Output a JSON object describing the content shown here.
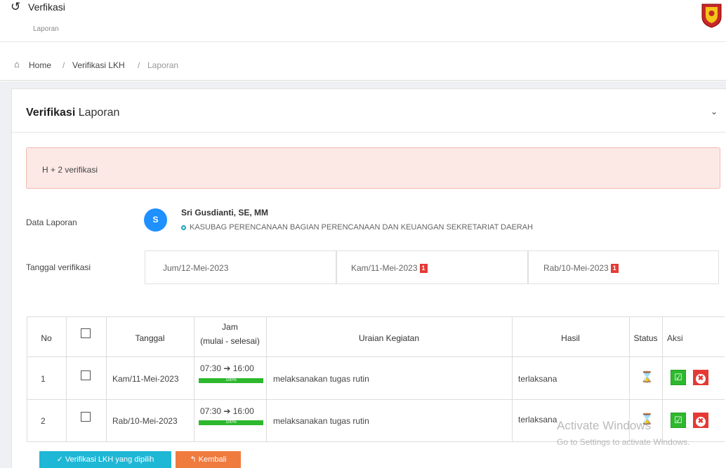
{
  "topbar": {
    "back_icon": "arrow-left-circle-icon",
    "title": "Verfikasi",
    "subtitle": "Laporan"
  },
  "breadcrumb": {
    "home_icon": "home-icon",
    "items": [
      "Home",
      "Verifikasi LKH",
      "Laporan"
    ],
    "separator": "/"
  },
  "card": {
    "title_bold": "Verifikasi",
    "title_rest": " Laporan",
    "collapse_icon": "chevron-down-icon"
  },
  "alert": {
    "text": "H + 2 verifikasi"
  },
  "report": {
    "label": "Data Laporan",
    "avatar_initial": "S",
    "name": "Sri Gusdianti, SE, MM",
    "role": "KASUBAG PERENCANAAN BAGIAN PERENCANAAN DAN KEUANGAN SEKRETARIAT DAERAH"
  },
  "verification_dates": {
    "label": "Tanggal verifikasi",
    "dates": [
      {
        "text": "Jum/12-Mei-2023",
        "badge": ""
      },
      {
        "text": "Kam/11-Mei-2023",
        "badge": "1"
      },
      {
        "text": "Rab/10-Mei-2023",
        "badge": "1"
      }
    ]
  },
  "table": {
    "headers": {
      "no": "No",
      "tanggal": "Tanggal",
      "jam_top": "Jam",
      "jam_bottom": "(mulai - selesai)",
      "uraian": "Uraian Kegiatan",
      "hasil": "Hasil",
      "status": "Status",
      "aksi": "Aksi"
    },
    "rows": [
      {
        "no": "1",
        "tanggal": "Kam/11-Mei-2023",
        "jam": "07:30 ➔ 16:00",
        "progress_label": "100%",
        "progress_pct": 100,
        "uraian": "melaksanakan tugas rutin",
        "hasil": "terlaksana",
        "status_icon": "hourglass-icon"
      },
      {
        "no": "2",
        "tanggal": "Rab/10-Mei-2023",
        "jam": "07:30 ➔ 16:00",
        "progress_label": "100%",
        "progress_pct": 100,
        "uraian": "melaksanakan tugas rutin",
        "hasil": "terlaksana",
        "status_icon": "hourglass-icon"
      }
    ]
  },
  "actions": {
    "verify_label": "✓ Verifikasi LKH yang dipilih",
    "back_label": "↰ Kembali"
  },
  "watermark": {
    "line1": "Activate Windows",
    "line2": "Go to Settings to activate Windows."
  },
  "colors": {
    "accent_blue": "#1e90ff",
    "verify_button": "#1fb7d6",
    "back_button": "#f07b3f",
    "success_green": "#2eb82e",
    "danger_red": "#e53935",
    "alert_bg": "#fce9e6"
  }
}
